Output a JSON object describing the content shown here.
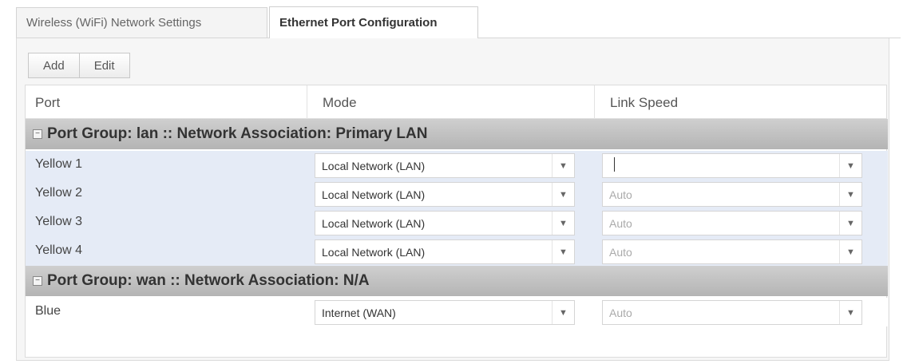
{
  "tabs": [
    {
      "label": "Wireless (WiFi) Network Settings"
    },
    {
      "label": "Ethernet Port Configuration"
    }
  ],
  "toolbar": {
    "add_label": "Add",
    "edit_label": "Edit"
  },
  "grid": {
    "headers": {
      "port": "Port",
      "mode": "Mode",
      "speed": "Link Speed"
    },
    "groups": [
      {
        "title": "Port Group: lan :: Network Association: Primary LAN",
        "rows": [
          {
            "port": "Yellow 1",
            "mode": "Local Network (LAN)",
            "speed": ""
          },
          {
            "port": "Yellow 2",
            "mode": "Local Network (LAN)",
            "speed": "Auto"
          },
          {
            "port": "Yellow 3",
            "mode": "Local Network (LAN)",
            "speed": "Auto"
          },
          {
            "port": "Yellow 4",
            "mode": "Local Network (LAN)",
            "speed": "Auto"
          }
        ]
      },
      {
        "title": "Port Group: wan :: Network Association: N/A",
        "rows": [
          {
            "port": "Blue",
            "mode": "Internet (WAN)",
            "speed": "Auto"
          }
        ]
      }
    ]
  },
  "icons": {
    "caret": "chevron-down-icon",
    "group_toggle": "collapse-icon"
  }
}
